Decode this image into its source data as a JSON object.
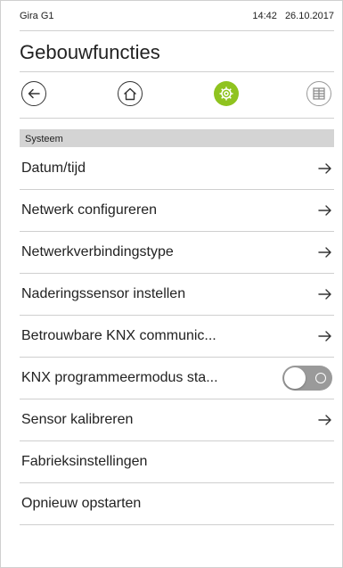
{
  "status": {
    "device": "Gira G1",
    "time": "14:42",
    "date": "26.10.2017"
  },
  "page": {
    "title": "Gebouwfuncties"
  },
  "nav": {
    "icons": [
      "back-arrow-icon",
      "home-icon",
      "settings-gear-icon",
      "grid-icon"
    ],
    "active_color": "#8fc31f"
  },
  "section": {
    "label": "Systeem"
  },
  "items": [
    {
      "label": "Datum/tijd",
      "control": "arrow"
    },
    {
      "label": "Netwerk configureren",
      "control": "arrow"
    },
    {
      "label": "Netwerkverbindingstype",
      "control": "arrow"
    },
    {
      "label": "Naderingssensor instellen",
      "control": "arrow"
    },
    {
      "label": "Betrouwbare KNX communic...",
      "control": "arrow"
    },
    {
      "label": "KNX programmeermodus sta...",
      "control": "toggle",
      "toggle_on": false
    },
    {
      "label": "Sensor kalibreren",
      "control": "arrow"
    },
    {
      "label": "Fabrieksinstellingen",
      "control": "none"
    },
    {
      "label": "Opnieuw opstarten",
      "control": "none"
    }
  ]
}
